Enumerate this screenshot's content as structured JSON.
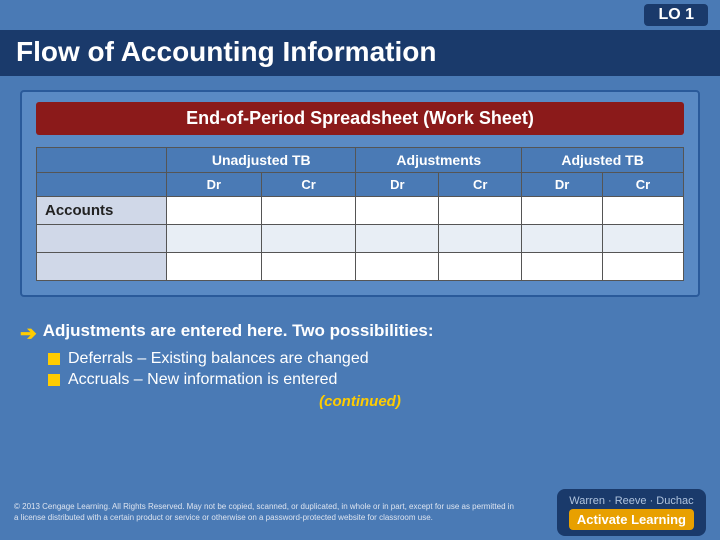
{
  "top_bar": {
    "lo_label": "LO 1"
  },
  "title": "Flow of Accounting Information",
  "worksheet": {
    "title": "End-of-Period Spreadsheet (Work Sheet)",
    "columns": {
      "unadjusted_tb": "Unadjusted TB",
      "adjustments": "Adjustments",
      "adjusted_tb": "Adjusted TB",
      "dr": "Dr",
      "cr": "Cr"
    },
    "accounts_label": "Accounts"
  },
  "body": {
    "arrow_text": "Adjustments are entered here. Two possibilities:",
    "bullet1": "Deferrals – Existing balances are changed",
    "bullet2": "Accruals – New information is entered",
    "continued": "(continued)"
  },
  "footer": {
    "copyright": "© 2013 Cengage Learning. All Rights Reserved. May not be copied, scanned, or duplicated, in whole or in part, except for use as permitted in a license distributed with a certain product or service or otherwise on a password-protected website for classroom use.",
    "brand_names": "Warren · Reeve · Duchac",
    "activate_learning": "Activate Learning"
  }
}
